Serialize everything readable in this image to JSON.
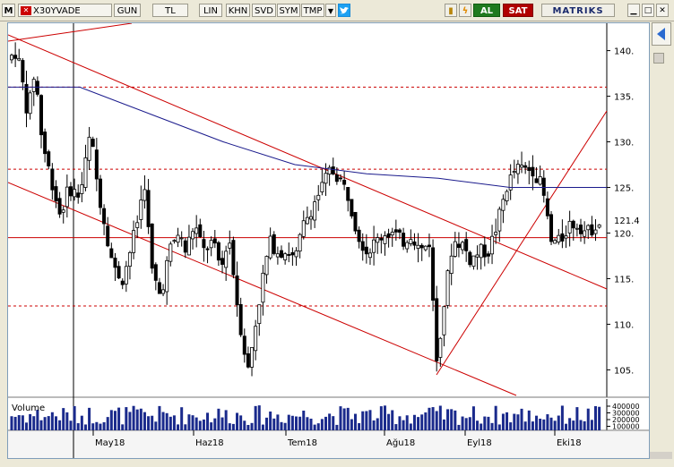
{
  "toolbar": {
    "menu_label": "M",
    "symbol": "X30YVADE",
    "period": "GUN",
    "currency": "TL",
    "scale_lin": "LIN",
    "khn": "KHN",
    "svd": "SVD",
    "sym": "SYM",
    "tmp": "TMP",
    "buy": "AL",
    "sell": "SAT",
    "brand": "MATRIKS"
  },
  "volume_label": "Volume",
  "chart_data": {
    "type": "candlestick",
    "ylim": [
      102,
      143
    ],
    "y_ticks": [
      105,
      110,
      115,
      120,
      125,
      130,
      135,
      140
    ],
    "x_ticks": [
      "May18",
      "Haz18",
      "Tem18",
      "Ağu18",
      "Eyl18",
      "Eki18"
    ],
    "last_price_label": "121.4",
    "horizontal_lines": [
      {
        "y": 119.5,
        "style": "solid",
        "color": "#cc0000"
      },
      {
        "y": 136,
        "style": "dashed",
        "color": "#cc0000"
      },
      {
        "y": 127,
        "style": "dashed",
        "color": "#cc0000"
      },
      {
        "y": 112,
        "style": "dashed",
        "color": "#cc0000"
      }
    ],
    "moving_average_color": "#1a1a8c",
    "volume_ticks": [
      "400000",
      "300000",
      "200000",
      "100000"
    ],
    "colors": {
      "up": "#ffffff",
      "down": "#000000",
      "trend": "#cc0000",
      "ma": "#1a1a8c"
    }
  }
}
